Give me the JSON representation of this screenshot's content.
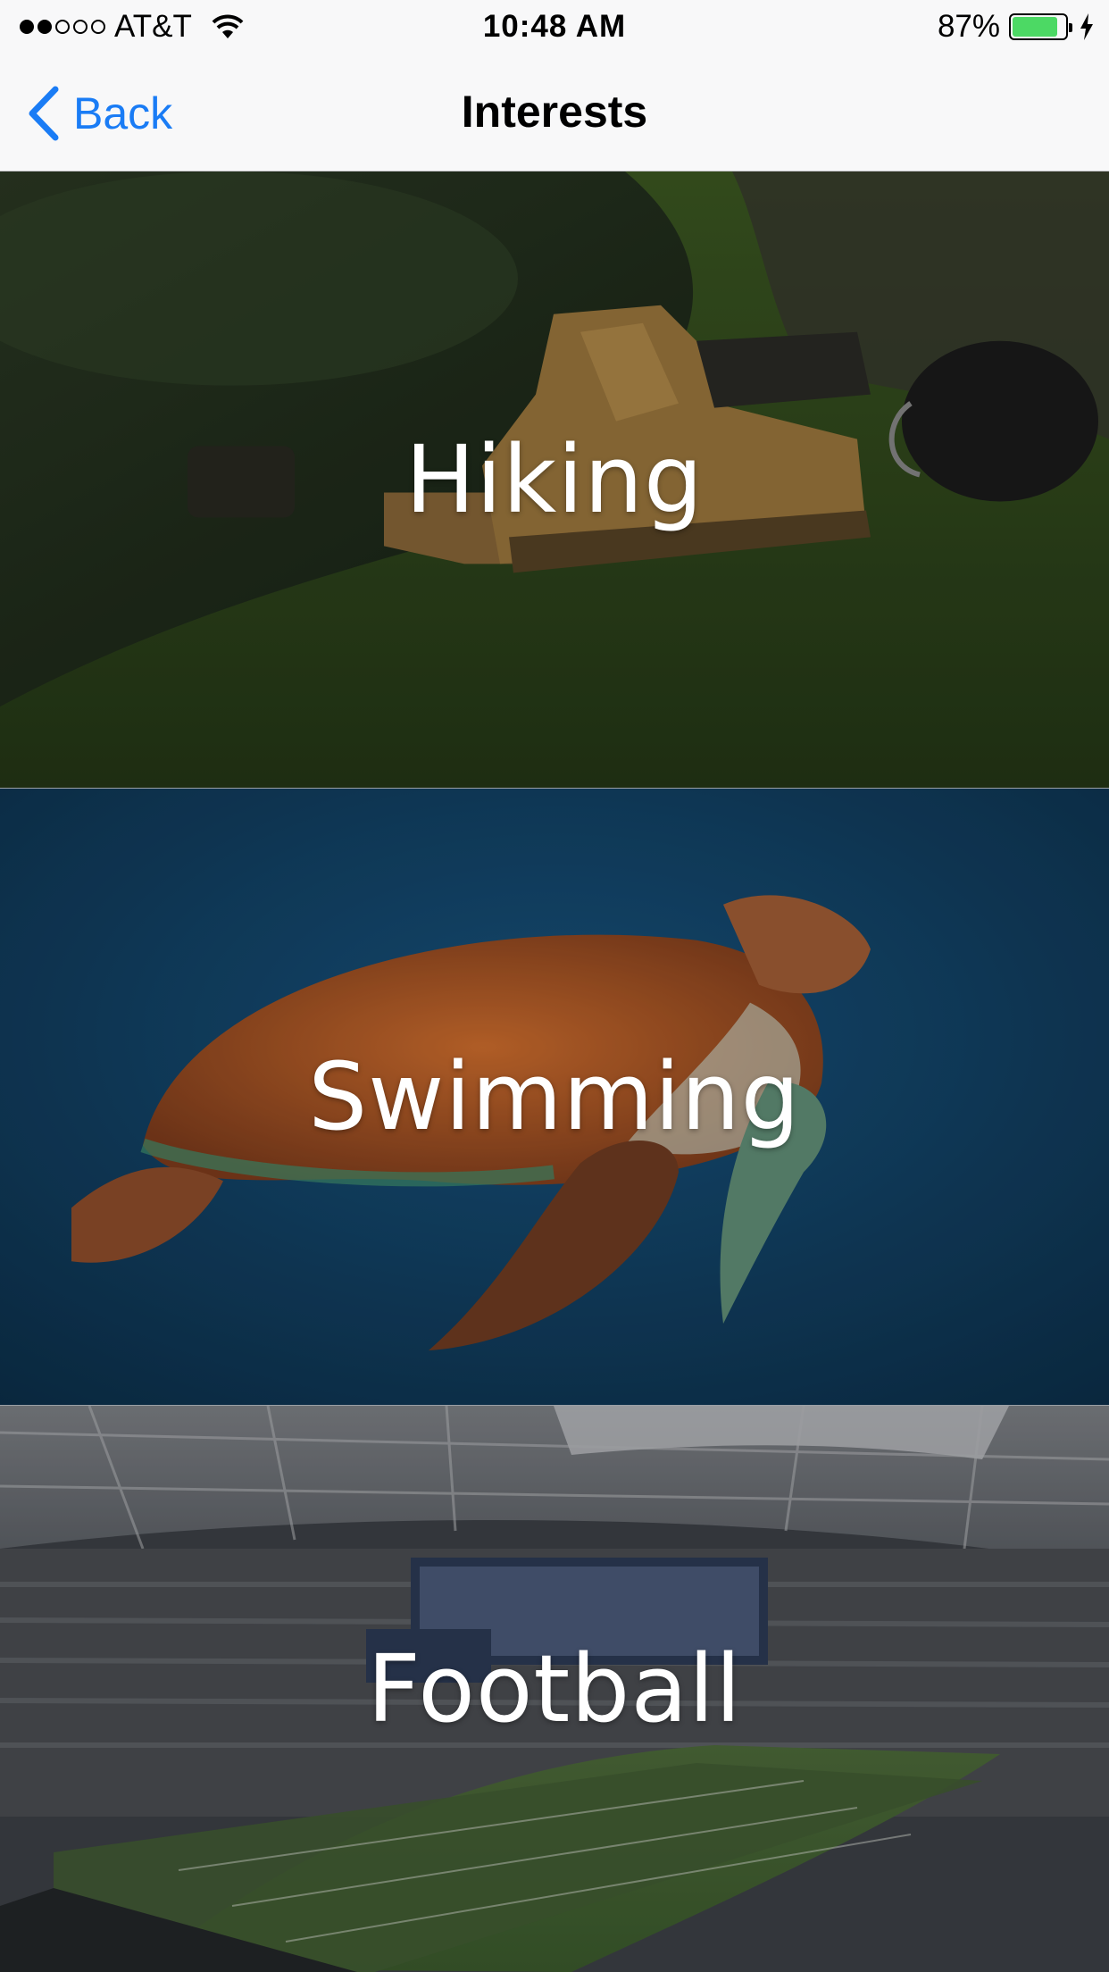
{
  "status_bar": {
    "carrier": "AT&T",
    "time": "10:48 AM",
    "battery_percent": "87%",
    "battery_level": 0.87,
    "signal_strength": 2,
    "signal_max": 5
  },
  "nav": {
    "back_label": "Back",
    "title": "Interests"
  },
  "interests": [
    {
      "label": "Hiking",
      "image": "hiking-boots-photo"
    },
    {
      "label": "Swimming",
      "image": "sea-turtle-photo"
    },
    {
      "label": "Football",
      "image": "football-stadium-photo"
    }
  ],
  "colors": {
    "accent": "#1a7cf5",
    "battery": "#4cd964",
    "bar_background": "#f8f8f9"
  }
}
